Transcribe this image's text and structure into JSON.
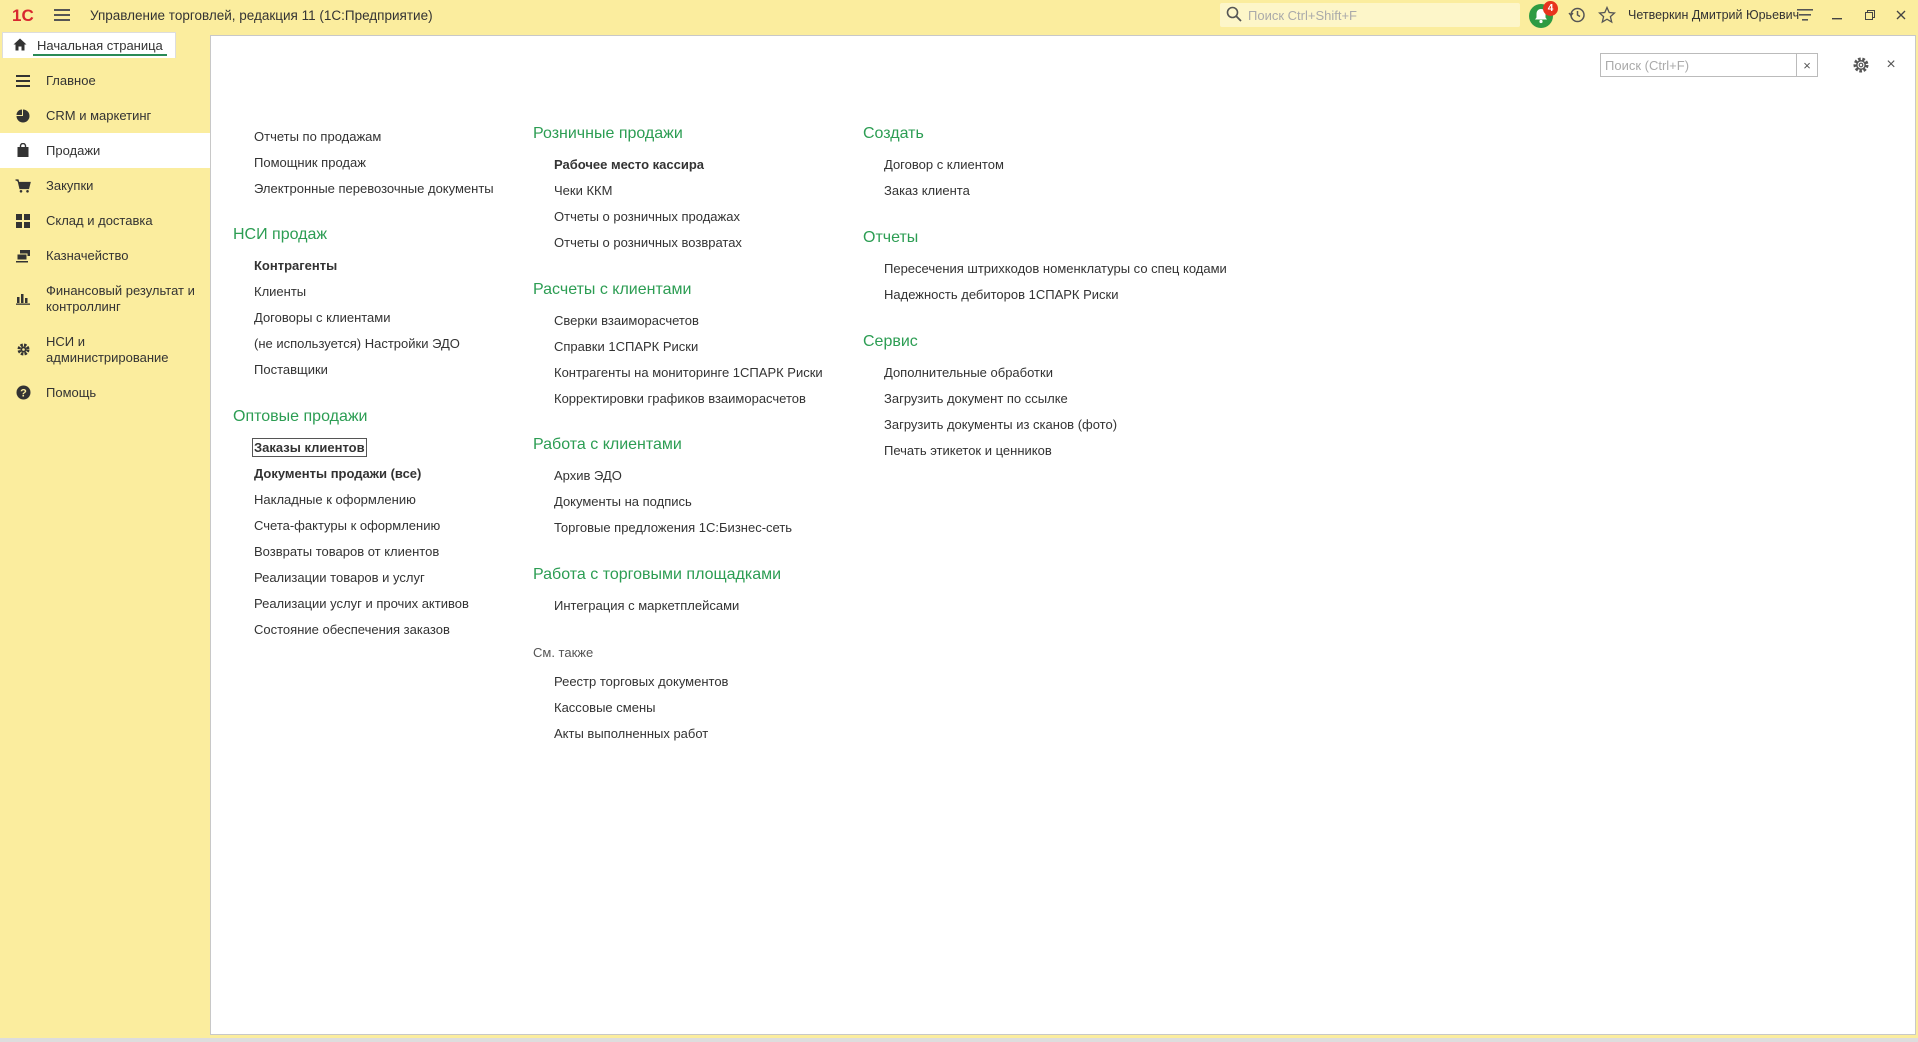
{
  "titlebar": {
    "logo": "1С",
    "title": "Управление торговлей, редакция 11  (1С:Предприятие)",
    "search_placeholder": "Поиск Ctrl+Shift+F",
    "notifications_count": "4",
    "user": "Четверкин Дмитрий Юрьевич",
    "icons": [
      "menu-icon",
      "search-icon",
      "bell-icon",
      "history-icon",
      "star-icon",
      "settings-lines-icon",
      "minimize-icon",
      "restore-icon",
      "close-icon"
    ]
  },
  "tabs": {
    "home": "Начальная страница"
  },
  "sidebar": {
    "items": [
      {
        "label": "Главное",
        "icon": "lines-icon"
      },
      {
        "label": "CRM и маркетинг",
        "icon": "pie-chart-icon"
      },
      {
        "label": "Продажи",
        "icon": "bag-icon",
        "active": true
      },
      {
        "label": "Закупки",
        "icon": "cart-icon"
      },
      {
        "label": "Склад и доставка",
        "icon": "grid-icon"
      },
      {
        "label": "Казначейство",
        "icon": "money-icon"
      },
      {
        "label": "Финансовый результат и контроллинг",
        "icon": "bar-chart-icon"
      },
      {
        "label": "НСИ и администрирование",
        "icon": "gear-icon"
      },
      {
        "label": "Помощь",
        "icon": "help-icon"
      }
    ]
  },
  "main": {
    "search_placeholder": "Поиск (Ctrl+F)",
    "clear": "×",
    "close": "×",
    "col1": {
      "top_links": [
        "Отчеты по продажам",
        "Помощник продаж",
        "Электронные перевозочные документы"
      ],
      "nsi_title": "НСИ продаж",
      "nsi_links": [
        "Контрагенты",
        "Клиенты",
        "Договоры с клиентами",
        "(не используется) Настройки ЭДО",
        "Поставщики"
      ],
      "wholesale_title": "Оптовые продажи",
      "wholesale_links": [
        "Заказы клиентов",
        "Документы продажи (все)",
        "Накладные к оформлению",
        "Счета-фактуры к оформлению",
        "Возвраты товаров от клиентов",
        "Реализации товаров и услуг",
        "Реализации услуг и прочих активов",
        "Состояние обеспечения заказов"
      ]
    },
    "col2": {
      "retail_title": "Розничные продажи",
      "retail_links": [
        "Рабочее место кассира",
        "Чеки ККМ",
        "Отчеты о розничных продажах",
        "Отчеты о розничных возвратах"
      ],
      "settlements_title": "Расчеты с клиентами",
      "settlements_links": [
        "Сверки взаиморасчетов",
        "Справки 1СПАРК Риски",
        "Контрагенты на мониторинге 1СПАРК Риски",
        "Корректировки графиков взаиморасчетов"
      ],
      "clients_title": "Работа с клиентами",
      "clients_links": [
        "Архив ЭДО",
        "Документы на подпись",
        "Торговые предложения 1С:Бизнес-сеть"
      ],
      "marketplaces_title": "Работа с торговыми площадками",
      "marketplaces_links": [
        "Интеграция с маркетплейсами"
      ],
      "see_also_title": "См. также",
      "see_also_links": [
        "Реестр торговых документов",
        "Кассовые смены",
        "Акты выполненных работ"
      ]
    },
    "col3": {
      "create_title": "Создать",
      "create_links": [
        "Договор с клиентом",
        "Заказ клиента"
      ],
      "reports_title": "Отчеты",
      "reports_links": [
        "Пересечения штрихкодов номенклатуры со спец кодами",
        "Надежность дебиторов 1СПАРК Риски"
      ],
      "service_title": "Сервис",
      "service_links": [
        "Дополнительные обработки",
        "Загрузить документ по ссылке",
        "Загрузить документы из сканов (фото)",
        "Печать этикеток и ценников"
      ]
    }
  }
}
